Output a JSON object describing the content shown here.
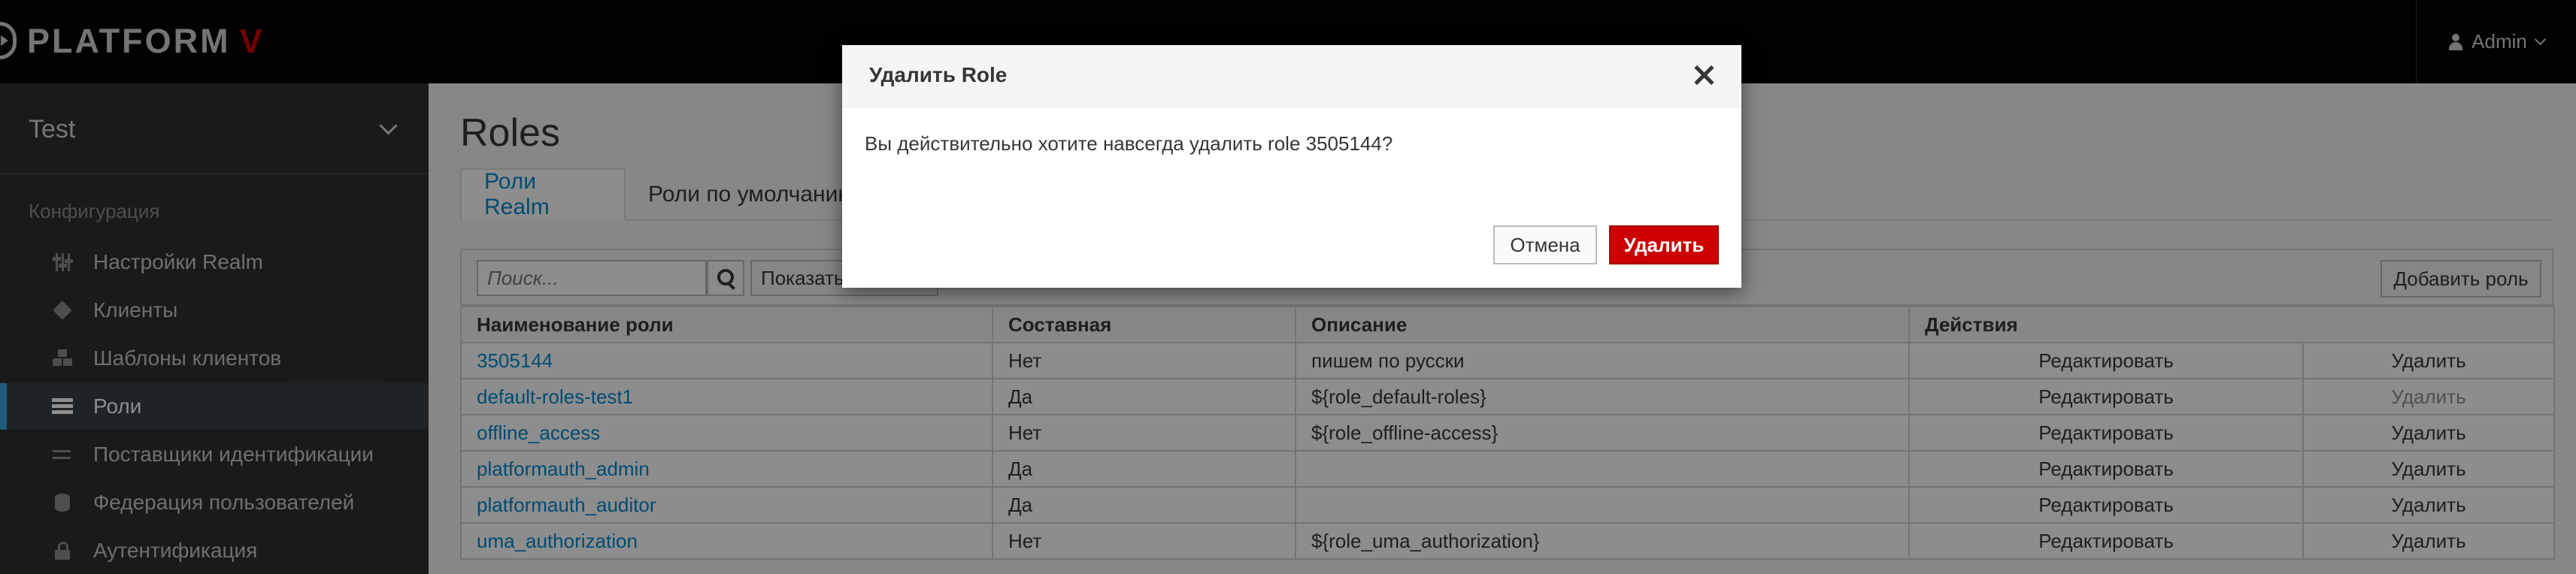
{
  "header": {
    "brand": "PLATFORM",
    "brand_accent": "V",
    "user": "Admin"
  },
  "sidebar": {
    "realm": "Test",
    "section": "Конфигурация",
    "items": [
      {
        "label": "Настройки Realm",
        "icon": "sliders-icon"
      },
      {
        "label": "Клиенты",
        "icon": "cube-icon"
      },
      {
        "label": "Шаблоны клиентов",
        "icon": "cubes-icon"
      },
      {
        "label": "Роли",
        "icon": "list-icon",
        "active": true
      },
      {
        "label": "Поставщики идентификации",
        "icon": "exchange-icon"
      },
      {
        "label": "Федерация пользователей",
        "icon": "database-icon"
      },
      {
        "label": "Аутентификация",
        "icon": "lock-icon"
      }
    ]
  },
  "main": {
    "title": "Roles",
    "tabs": [
      {
        "label": "Роли Realm",
        "active": true
      },
      {
        "label": "Роли по умолчанию"
      }
    ],
    "search_placeholder": "Поиск...",
    "show_all_label": "Показать",
    "add_role_label": "Добавить роль",
    "table": {
      "columns": [
        "Наименование роли",
        "Составная",
        "Описание",
        "Действия"
      ],
      "rows": [
        {
          "name": "3505144",
          "composite": "Нет",
          "description": "пишем по русски",
          "edit": "Редактировать",
          "delete": "Удалить"
        },
        {
          "name": "default-roles-test1",
          "composite": "Да",
          "description": "${role_default-roles}",
          "edit": "Редактировать",
          "delete": "Удалить"
        },
        {
          "name": "offline_access",
          "composite": "Нет",
          "description": "${role_offline-access}",
          "edit": "Редактировать",
          "delete": "Удалить"
        },
        {
          "name": "platformauth_admin",
          "composite": "Да",
          "description": "",
          "edit": "Редактировать",
          "delete": "Удалить"
        },
        {
          "name": "platformauth_auditor",
          "composite": "Да",
          "description": "",
          "edit": "Редактировать",
          "delete": "Удалить"
        },
        {
          "name": "uma_authorization",
          "composite": "Нет",
          "description": "${role_uma_authorization}",
          "edit": "Редактировать",
          "delete": "Удалить"
        }
      ]
    }
  },
  "modal": {
    "title": "Удалить Role",
    "message": "Вы действительно хотите навсегда удалить role 3505144?",
    "cancel_label": "Отмена",
    "delete_label": "Удалить"
  },
  "colors": {
    "accent": "#0088ce",
    "danger": "#cc0000",
    "sidebar_bg": "#2c2f32",
    "header_bg": "#030303"
  }
}
